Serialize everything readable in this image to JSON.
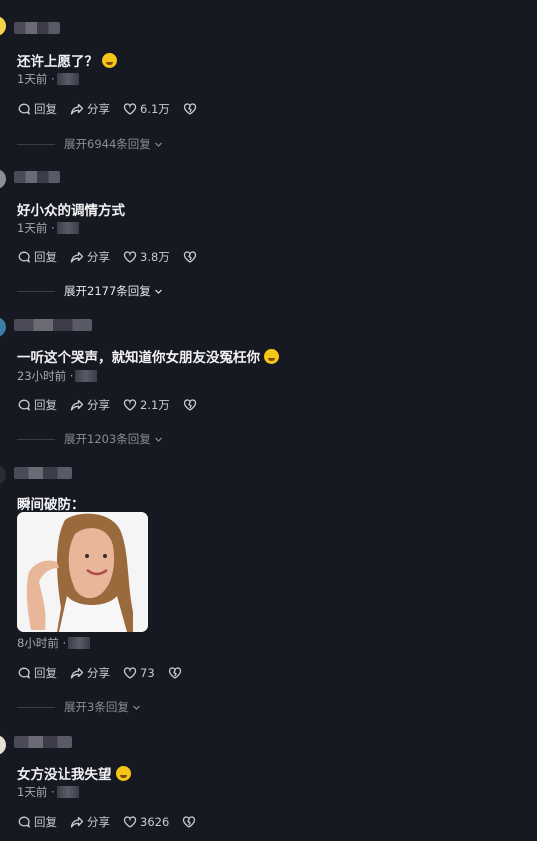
{
  "labels": {
    "reply": "回复",
    "share": "分享"
  },
  "comments": [
    {
      "text": "还许上愿了？",
      "emoji": "😂",
      "time": "1天前 ·",
      "likes": "6.1万",
      "expand": "展开6944条回复"
    },
    {
      "text": "好小众的调情方式",
      "time": "1天前 ·",
      "likes": "3.8万",
      "expand": "展开2177条回复"
    },
    {
      "text": "一听这个哭声，就知道你女朋友没冤枉你",
      "emoji": "🤣",
      "time": "23小时前 ·",
      "likes": "2.1万",
      "expand": "展开1203条回复"
    },
    {
      "text": "瞬间破防：",
      "time": "8小时前 ·",
      "likes": "73",
      "expand": "展开3条回复"
    },
    {
      "text": "女方没让我失望",
      "emoji": "😘",
      "time": "1天前 ·",
      "likes": "3626"
    }
  ],
  "colors": {
    "background": "#161822",
    "text_primary": "#f2f2f5",
    "text_secondary": "#a8a9b2",
    "expand_muted": "#8a8b95"
  }
}
